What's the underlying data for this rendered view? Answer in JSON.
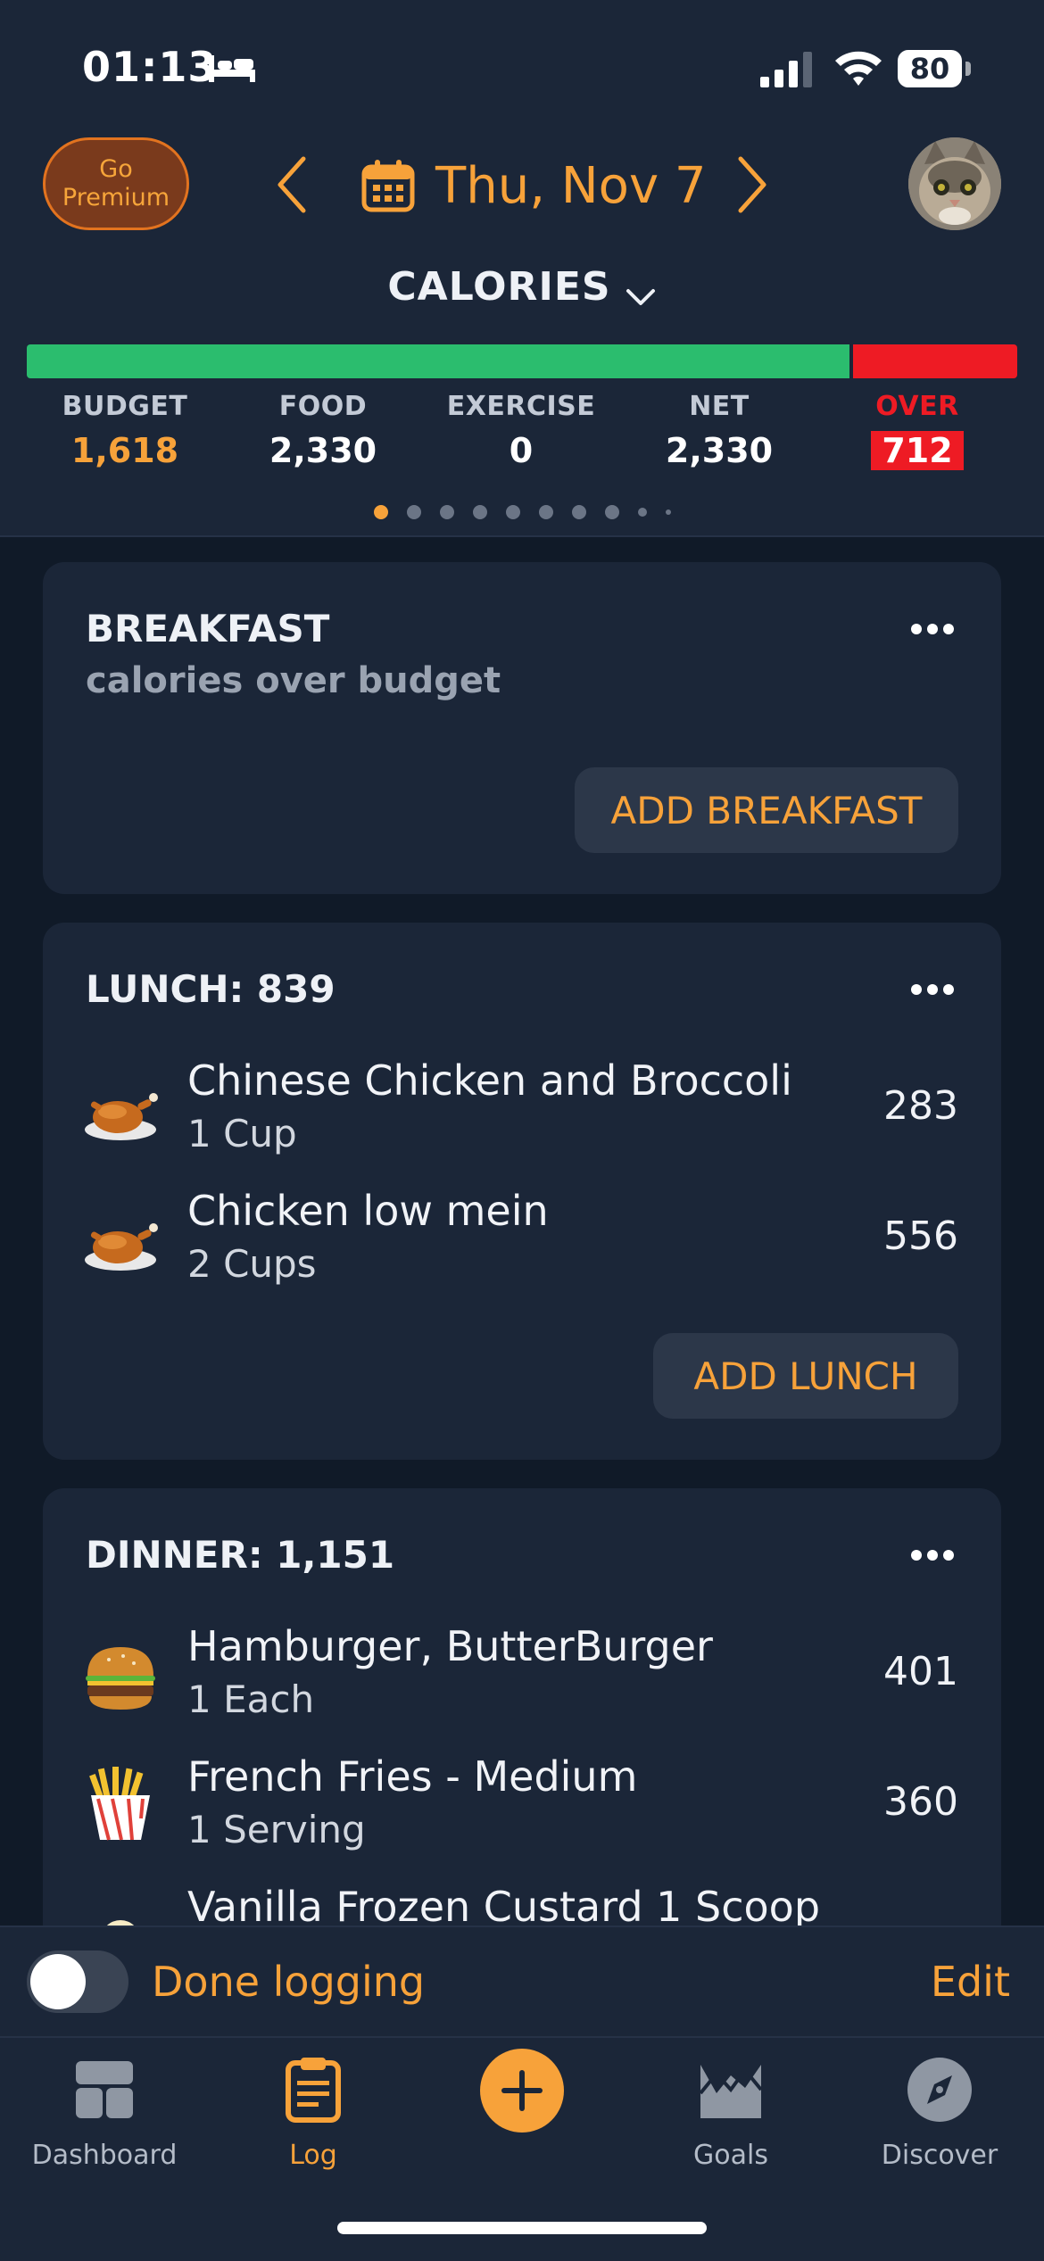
{
  "status_bar": {
    "time": "01:13",
    "battery": "80"
  },
  "header": {
    "premium_label": "Go Premium",
    "date": "Thu, Nov 7",
    "metric_selector": "CALORIES"
  },
  "summary": {
    "budget_label": "BUDGET",
    "budget_value": "1,618",
    "food_label": "FOOD",
    "food_value": "2,330",
    "exercise_label": "EXERCISE",
    "exercise_value": "0",
    "net_label": "NET",
    "net_value": "2,330",
    "over_label": "OVER",
    "over_value": "712",
    "consumed_fraction_of_bar": 0.84
  },
  "pager": {
    "count": 10,
    "active_index": 0
  },
  "breakfast": {
    "title": "BREAKFAST",
    "subtitle": "calories over budget",
    "add_label": "ADD BREAKFAST"
  },
  "lunch": {
    "title": "LUNCH: 839",
    "items": [
      {
        "name": "Chinese Chicken and Broccoli",
        "serving": "1 Cup",
        "calories": "283",
        "icon": "roast-chicken-icon"
      },
      {
        "name": "Chicken low mein",
        "serving": "2 Cups",
        "calories": "556",
        "icon": "roast-chicken-icon"
      }
    ],
    "add_label": "ADD LUNCH"
  },
  "dinner": {
    "title": "DINNER: 1,151",
    "items": [
      {
        "name": "Hamburger, ButterBurger",
        "serving": "1 Each",
        "calories": "401",
        "icon": "hamburger-icon"
      },
      {
        "name": "French Fries - Medium",
        "serving": "1 Serving",
        "calories": "360",
        "icon": "french-fries-icon"
      },
      {
        "name": "Vanilla Frozen Custard 1 Scoop",
        "serving": "",
        "calories": "",
        "icon": "custard-icon"
      }
    ]
  },
  "done_logging": {
    "label": "Done logging",
    "edit_label": "Edit",
    "toggle_on": false
  },
  "tabbar": {
    "dashboard": "Dashboard",
    "log": "Log",
    "goals": "Goals",
    "discover": "Discover"
  },
  "colors": {
    "accent": "#f7a23a",
    "over_red": "#ee1b24",
    "progress_green": "#2bbd6e",
    "background": "#101a28",
    "card": "#1b2638"
  }
}
